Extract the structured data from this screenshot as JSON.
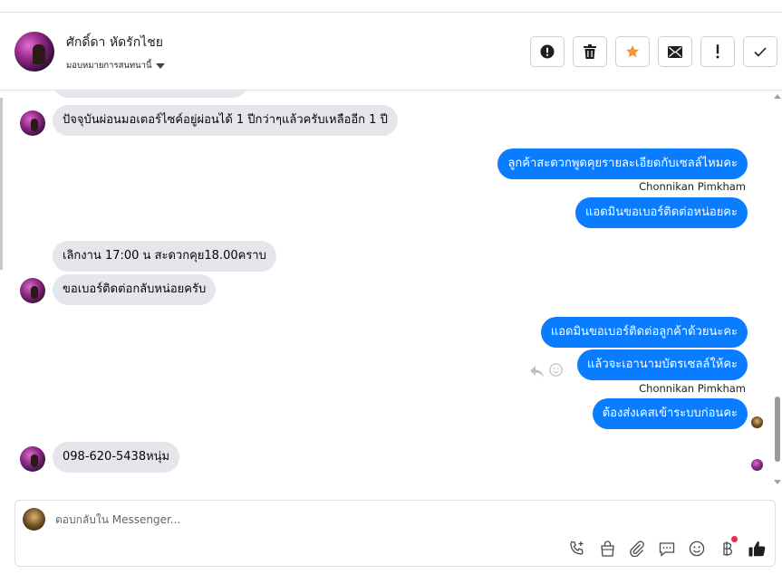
{
  "contact": {
    "name": "ศักดิ์ดา หัดรักไชย",
    "assign_label": "มอบหมายการสนทนานี้"
  },
  "header_actions": [
    {
      "name": "spam-button",
      "icon": "alert-circle-icon"
    },
    {
      "name": "delete-button",
      "icon": "trash-icon"
    },
    {
      "name": "star-button",
      "icon": "star-icon",
      "color": "#f7923b"
    },
    {
      "name": "mark-unread-button",
      "icon": "envelope-icon"
    },
    {
      "name": "follow-up-button",
      "icon": "exclamation-icon"
    },
    {
      "name": "done-button",
      "icon": "checkmark-icon"
    }
  ],
  "messages": [
    {
      "side": "in",
      "text": "ปัจจุบันผ่อนมอเตอร์ไซค์อยู่ผ่อนได้ 1 ปีกว่าๆแล้วครับเหลืออีก 1 ปี"
    },
    {
      "side": "out",
      "text": "ลูกค้าสะดวกพูดคุยรายละเอียดกับเซลล์ไหมคะ"
    },
    {
      "side": "sender",
      "text": "Chonnikan Pimkham"
    },
    {
      "side": "out",
      "text": "แอดมินขอเบอร์ติดต่อหน่อยคะ"
    },
    {
      "side": "in",
      "text": "เลิกงาน 17:00 น สะดวกคุย18.00คราบ"
    },
    {
      "side": "in",
      "text": "ขอเบอร์ติดต่อกลับหน่อยครับ"
    },
    {
      "side": "out",
      "text": "แอดมินขอเบอร์ติดต่อลูกค้าด้วยนะคะ"
    },
    {
      "side": "out",
      "text": "แล้วจะเอานามบัตรเซลล์ให้คะ"
    },
    {
      "side": "sender",
      "text": "Chonnikan Pimkham"
    },
    {
      "side": "out",
      "text": "ต้องส่งเคสเข้าระบบก่อนคะ"
    },
    {
      "side": "in",
      "text": "098-620-5438หนุ่ม"
    }
  ],
  "composer": {
    "placeholder": "ตอบกลับใน Messenger...",
    "tools": [
      "phone-add-icon",
      "shopping-bag-icon",
      "paperclip-icon",
      "saved-reply-icon",
      "emoji-icon",
      "baht-icon",
      "thumbs-up-icon"
    ]
  },
  "colors": {
    "outgoing_bubble": "#0a7cff",
    "incoming_bubble": "#e4e6eb",
    "notification_dot": "#f02849"
  }
}
